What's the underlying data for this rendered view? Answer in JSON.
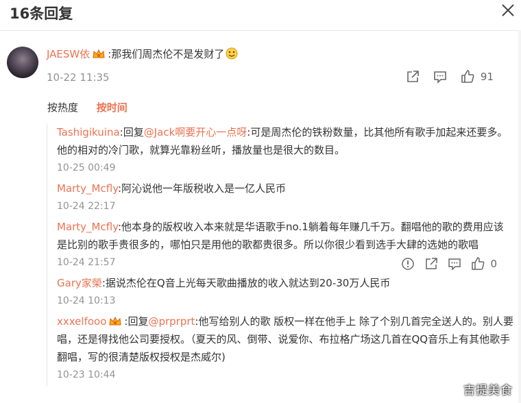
{
  "header": {
    "title": "16条回复"
  },
  "main_comment": {
    "username": "JAESW依",
    "text": ":那我们周杰伦不是发财了",
    "time": "10-22 11:35",
    "like_count": "91"
  },
  "sort": {
    "hot": "按热度",
    "time": "按时间"
  },
  "replies": [
    {
      "name": "Tashigikuina",
      "prefix": ":回复",
      "mention": "@Jack啊要开心一点呀",
      "text": ":可是周杰伦的铁粉数量，比其他所有歌手加起来还要多。他的相对的冷门歌，就算光靠粉丝听，播放量也是很大的数目。",
      "time": "10-25 00:49"
    },
    {
      "name": "Marty_Mcfly",
      "text": ":阿沁说他一年版税收入是一亿人民币",
      "time": "10-24 22:17"
    },
    {
      "name": "Marty_Mcfly",
      "text": ":他本身的版权收入本来就是华语歌手no.1躺着每年赚几千万。翻唱他的歌的费用应该是比别的歌手贵很多的，哪怕只是用他的歌都贵很多。所以你很少看到选手大肆的选她的歌唱",
      "time": "10-24 21:57",
      "like_count": "0"
    },
    {
      "name": "Gary家榮",
      "text": ":据说杰伦在Q音上光每天歌曲播放的收入就达到20-30万人民币",
      "time": "10-24 10:13"
    },
    {
      "name": "xxxelfooo",
      "prefix": ":回复",
      "mention": "@prprprt",
      "text": ":他写给别人的歌 版权一样在他手上 除了个别几首完全送人的。别人要唱，还是得找他公司要授权。（夏天的风、倒带、说爱你、布拉格广场这几首在QQ音乐上有其他歌手翻唱，写的很清楚版权授权是杰威尔)",
      "time": "10-23 10:44"
    }
  ],
  "watermark": "吉提美食",
  "colors": {
    "accent": "#eb7350",
    "muted": "#939393",
    "text": "#333333"
  },
  "icons": [
    "close-icon",
    "share-icon",
    "comment-icon",
    "like-icon",
    "report-icon",
    "vip-crown-icon",
    "emoji-icon"
  ]
}
